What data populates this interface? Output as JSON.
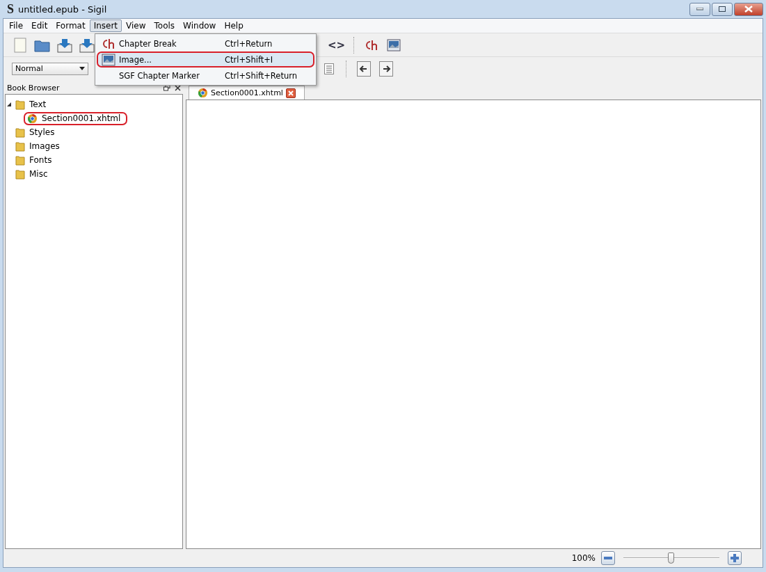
{
  "window": {
    "title": "untitled.epub - Sigil",
    "logo": "S"
  },
  "menubar": [
    {
      "label": "File",
      "selected": false
    },
    {
      "label": "Edit",
      "selected": false
    },
    {
      "label": "Format",
      "selected": false
    },
    {
      "label": "Insert",
      "selected": true
    },
    {
      "label": "View",
      "selected": false
    },
    {
      "label": "Tools",
      "selected": false
    },
    {
      "label": "Window",
      "selected": false
    },
    {
      "label": "Help",
      "selected": false
    }
  ],
  "open_menu": {
    "items": [
      {
        "label": "Chapter Break",
        "shortcut": "Ctrl+Return",
        "kind": "chapter",
        "selected": false,
        "annotated": false
      },
      {
        "label": "Image...",
        "shortcut": "Ctrl+Shift+I",
        "kind": "image",
        "selected": true,
        "annotated": true
      },
      {
        "label": "SGF Chapter Marker",
        "shortcut": "Ctrl+Shift+Return",
        "kind": "none",
        "selected": false,
        "annotated": false
      }
    ]
  },
  "toolbar": {
    "code_view": "<>",
    "style_dropdown": "Normal"
  },
  "book_browser": {
    "title": "Book Browser",
    "tree": [
      {
        "label": "Text",
        "kind": "folder",
        "expanded": true,
        "children": [
          {
            "label": "Section0001.xhtml",
            "kind": "file",
            "annotated": true
          }
        ]
      },
      {
        "label": "Styles",
        "kind": "folder"
      },
      {
        "label": "Images",
        "kind": "folder"
      },
      {
        "label": "Fonts",
        "kind": "folder"
      },
      {
        "label": "Misc",
        "kind": "folder"
      }
    ]
  },
  "tabs": [
    {
      "label": "Section0001.xhtml",
      "selected": true
    }
  ],
  "status_bar": {
    "zoom": "100%",
    "zoom_slider": {
      "level": 0.5
    }
  }
}
